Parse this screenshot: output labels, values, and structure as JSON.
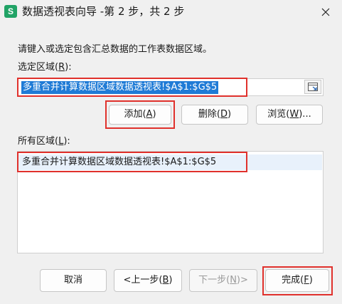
{
  "window": {
    "app_icon_letter": "S",
    "title": "数据透视表向导 -第 2 步，共 2 步"
  },
  "instruction": "请键入或选定包含汇总数据的工作表数据区域。",
  "selected_range": {
    "label": "选定区域(",
    "hotkey": "R",
    "label_end": "):",
    "value": "多重合并计算数据区域数据透视表!$A$1:$G$5"
  },
  "range_buttons": {
    "add": {
      "label": "添加(",
      "hotkey": "A",
      "end": ")"
    },
    "delete": {
      "label": "删除(",
      "hotkey": "D",
      "end": ")"
    },
    "browse": {
      "label": "浏览(",
      "hotkey": "W",
      "end": ")..."
    }
  },
  "all_ranges": {
    "label": "所有区域(",
    "hotkey": "L",
    "label_end": "):",
    "items": [
      "多重合并计算数据区域数据透视表!$A$1:$G$5"
    ]
  },
  "footer_buttons": {
    "cancel": {
      "label": "取消"
    },
    "back": {
      "label": "<上一步(",
      "hotkey": "B",
      "end": ")"
    },
    "next": {
      "label": "下一步(",
      "hotkey": "N",
      "end": ")>"
    },
    "finish": {
      "label": "完成(",
      "hotkey": "F",
      "end": ")"
    }
  },
  "colors": {
    "highlight": "#1f7bd6",
    "annotation_red": "#e0312c",
    "app_green": "#21a366"
  }
}
